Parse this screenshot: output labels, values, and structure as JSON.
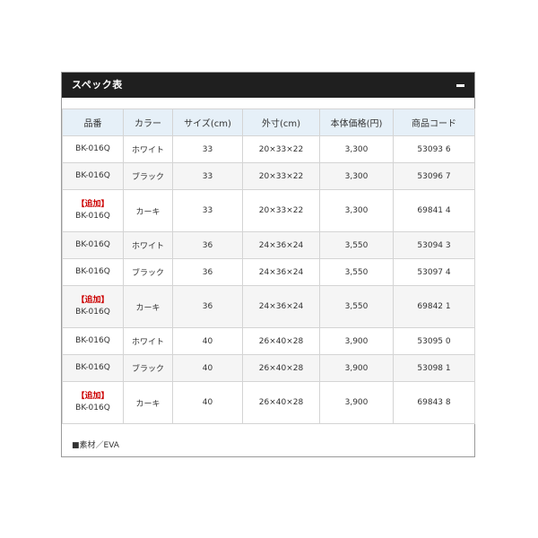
{
  "panel": {
    "title": "スペック表"
  },
  "table": {
    "headers": [
      "品番",
      "カラー",
      "サイズ(cm)",
      "外寸(cm)",
      "本体価格(円)",
      "商品コード"
    ],
    "rows": [
      {
        "tag": "",
        "code": "BK-016Q",
        "color": "ホワイト",
        "size": "33",
        "dims": "20×33×22",
        "price": "3,300",
        "product_code": "53093 6"
      },
      {
        "tag": "",
        "code": "BK-016Q",
        "color": "ブラック",
        "size": "33",
        "dims": "20×33×22",
        "price": "3,300",
        "product_code": "53096 7"
      },
      {
        "tag": "【追加】",
        "code": "BK-016Q",
        "color": "カーキ",
        "size": "33",
        "dims": "20×33×22",
        "price": "3,300",
        "product_code": "69841 4"
      },
      {
        "tag": "",
        "code": "BK-016Q",
        "color": "ホワイト",
        "size": "36",
        "dims": "24×36×24",
        "price": "3,550",
        "product_code": "53094 3"
      },
      {
        "tag": "",
        "code": "BK-016Q",
        "color": "ブラック",
        "size": "36",
        "dims": "24×36×24",
        "price": "3,550",
        "product_code": "53097 4"
      },
      {
        "tag": "【追加】",
        "code": "BK-016Q",
        "color": "カーキ",
        "size": "36",
        "dims": "24×36×24",
        "price": "3,550",
        "product_code": "69842 1"
      },
      {
        "tag": "",
        "code": "BK-016Q",
        "color": "ホワイト",
        "size": "40",
        "dims": "26×40×28",
        "price": "3,900",
        "product_code": "53095 0"
      },
      {
        "tag": "",
        "code": "BK-016Q",
        "color": "ブラック",
        "size": "40",
        "dims": "26×40×28",
        "price": "3,900",
        "product_code": "53098 1"
      },
      {
        "tag": "【追加】",
        "code": "BK-016Q",
        "color": "カーキ",
        "size": "40",
        "dims": "26×40×28",
        "price": "3,900",
        "product_code": "69843 8"
      }
    ]
  },
  "footer": {
    "material_note": "■素材／EVA"
  },
  "colors": {
    "header_bg": "#1f1f1f",
    "table_header_bg": "#e6f0f8",
    "tag_red": "#cc0000"
  },
  "icons": {
    "collapse": "minus-icon"
  }
}
